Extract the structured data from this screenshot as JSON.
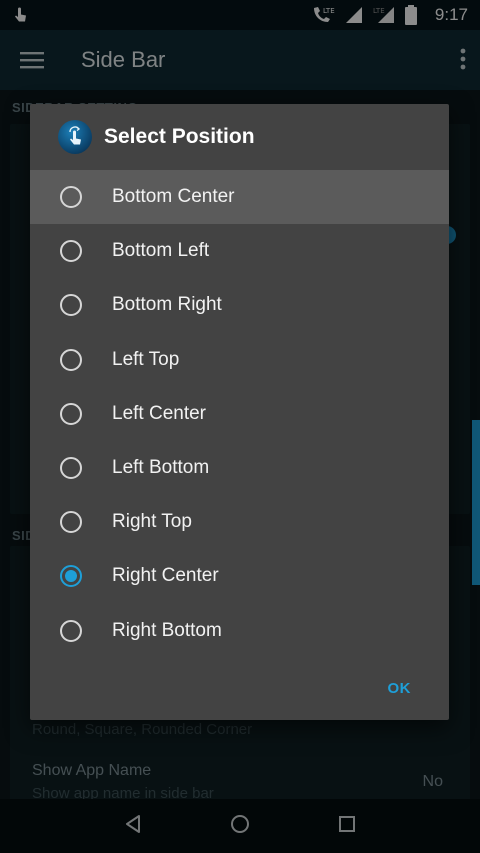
{
  "status_bar": {
    "network": "LTE",
    "time": "9:17",
    "icons": [
      "touch-icon",
      "phone-lte-icon",
      "signal-icon",
      "lte-signal-icon",
      "battery-icon"
    ]
  },
  "app_bar": {
    "title": "Side Bar",
    "icons": [
      "menu-icon",
      "overflow-menu-icon"
    ]
  },
  "background": {
    "section_1": "SIDEBAR SETTING",
    "section_2": "SIDE",
    "settings": [
      {
        "title": "",
        "subtitle": "Round, Square, Rounded Corner",
        "value": ""
      },
      {
        "title": "Show App Name",
        "subtitle": "Show app name in side bar",
        "value": "No"
      }
    ]
  },
  "dialog": {
    "title": "Select Position",
    "icon": "touch-hand-icon",
    "options": [
      {
        "label": "Bottom Center",
        "checked": false,
        "highlighted": true
      },
      {
        "label": "Bottom Left",
        "checked": false,
        "highlighted": false
      },
      {
        "label": "Bottom Right",
        "checked": false,
        "highlighted": false
      },
      {
        "label": "Left Top",
        "checked": false,
        "highlighted": false
      },
      {
        "label": "Left Center",
        "checked": false,
        "highlighted": false
      },
      {
        "label": "Left Bottom",
        "checked": false,
        "highlighted": false
      },
      {
        "label": "Right Top",
        "checked": false,
        "highlighted": false
      },
      {
        "label": "Right Center",
        "checked": true,
        "highlighted": false
      },
      {
        "label": "Right Bottom",
        "checked": false,
        "highlighted": false
      }
    ],
    "ok_label": "OK"
  },
  "colors": {
    "accent": "#1e9fd8",
    "dialog_bg": "#434343",
    "highlight_row": "#5b5b5b",
    "appbar": "#0f2a33"
  },
  "nav_bar": {
    "icons": [
      "back-icon",
      "home-icon",
      "recents-icon"
    ]
  }
}
